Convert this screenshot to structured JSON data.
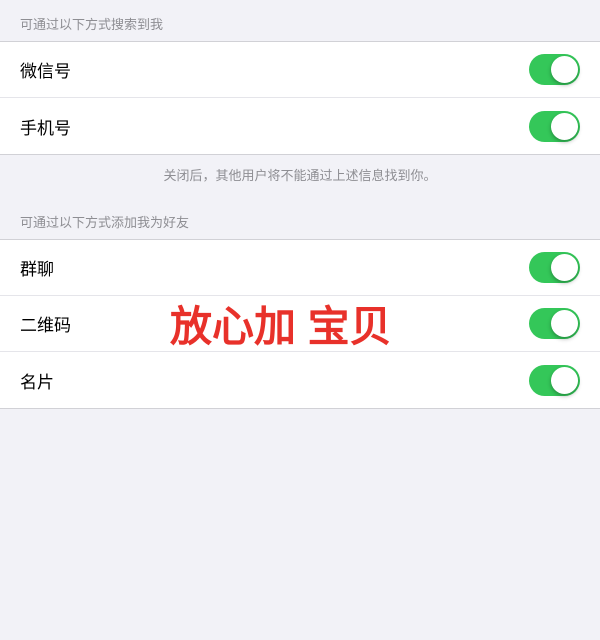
{
  "section1": {
    "header": "可通过以下方式搜索到我",
    "rows": [
      {
        "label": "微信号",
        "toggled": true
      },
      {
        "label": "手机号",
        "toggled": true
      }
    ]
  },
  "note": {
    "text": "关闭后，其他用户将不能通过上述信息找到你。"
  },
  "section2": {
    "header": "可通过以下方式添加我为好友",
    "rows": [
      {
        "label": "群聊",
        "toggled": true
      },
      {
        "label": "二维码",
        "toggled": true
      },
      {
        "label": "名片",
        "toggled": true
      }
    ]
  },
  "overlay": {
    "text": "放心加 宝贝"
  },
  "colors": {
    "toggle_on": "#34c759",
    "overlay_text": "#e8312a"
  }
}
